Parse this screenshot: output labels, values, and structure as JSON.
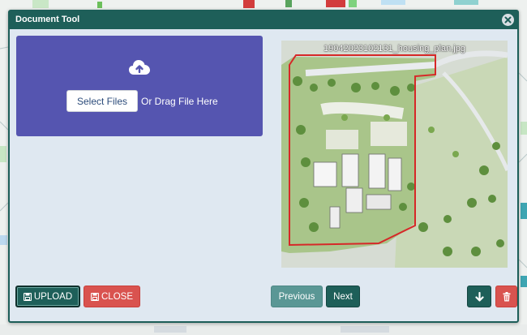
{
  "dialog": {
    "title": "Document Tool"
  },
  "dropzone": {
    "select_label": "Select Files",
    "drag_label": "Or Drag File Here",
    "icon": "cloud-upload-icon"
  },
  "preview": {
    "filename": "19042023102131_housing_plan.jpg"
  },
  "footer": {
    "upload_label": "UPLOAD",
    "close_label": "CLOSE",
    "previous_label": "Previous",
    "next_label": "Next",
    "download_icon": "arrow-down-icon",
    "delete_icon": "trash-icon"
  },
  "colors": {
    "primary": "#1e5f59",
    "danger": "#d9534f",
    "dropzone": "#5555b0",
    "dialog_bg": "#dfe8f1",
    "secondary": "#5a9795"
  }
}
